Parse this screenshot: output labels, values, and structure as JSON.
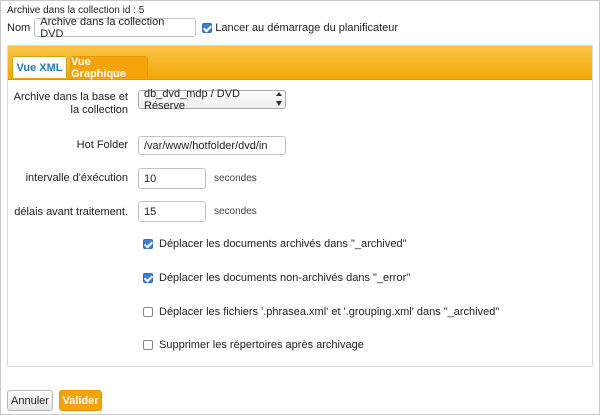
{
  "header": {
    "title": "Archive dans la collection id : 5"
  },
  "nom": {
    "label": "Nom",
    "value": "Archive dans la collection DVD",
    "scheduler_checked": true,
    "scheduler_label": "Lancer au démarrage du planificateur"
  },
  "tabs": [
    {
      "label": "Vue XML",
      "active": false
    },
    {
      "label": "Vue Graphique",
      "active": true
    }
  ],
  "form": {
    "archive_label_line1": "Archive dans la base et",
    "archive_label_line2": "la collection",
    "archive_value": "db_dvd_mdp / DVD Réserve",
    "hotfolder_label": "Hot Folder",
    "hotfolder_value": "/var/www/hotfolder/dvd/in",
    "interval_label": "intervalle d'éxécution",
    "interval_value": "10",
    "interval_unit": "secondes",
    "delay_label": "délais avant traitement.",
    "delay_value": "15",
    "delay_unit": "secondes"
  },
  "options": [
    {
      "label": "Déplacer les documents archivés dans \"_archived\"",
      "checked": true
    },
    {
      "label": "Déplacer les documents non-archivés dans \"_error\"",
      "checked": true
    },
    {
      "label": "Déplacer les fichiers '.phrasea.xml' et '.grouping.xml' dans \"_archived\"",
      "checked": false
    },
    {
      "label": "Supprimer les répertoires après archivage",
      "checked": false
    }
  ],
  "buttons": {
    "cancel": "Annuler",
    "submit": "Valider"
  },
  "colors": {
    "accent": "#f5a308",
    "tab_link": "#1f7abf",
    "checkbox": "#3b7fd6"
  }
}
